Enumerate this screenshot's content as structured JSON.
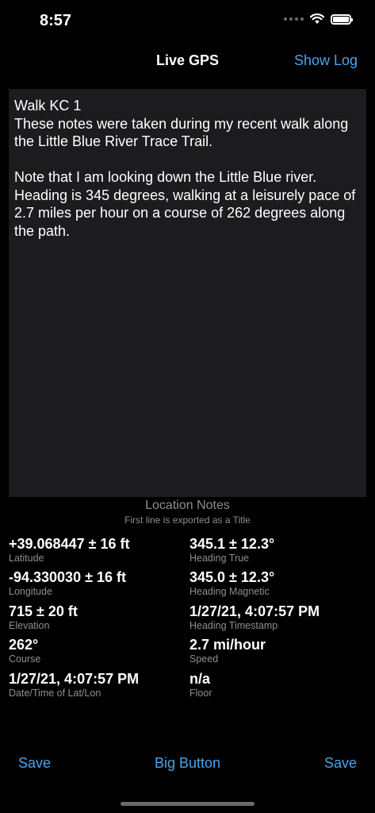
{
  "status_bar": {
    "time": "8:57"
  },
  "nav": {
    "title": "Live GPS",
    "show_log_label": "Show Log"
  },
  "notes": {
    "text": "Walk KC 1\nThese notes were taken during my recent walk along the Little Blue River Trace Trail.\n\nNote that I am looking down the Little Blue river. Heading is 345 degrees, walking at a leisurely pace of 2.7 miles per hour on a course of 262 degrees along the path.",
    "caption_title": "Location Notes",
    "caption_subtitle": "First line is exported as a Title"
  },
  "metrics": {
    "latitude": {
      "value": "+39.068447 ± 16 ft",
      "label": "Latitude"
    },
    "longitude": {
      "value": "-94.330030 ± 16 ft",
      "label": "Longitude"
    },
    "elevation": {
      "value": "715 ± 20 ft",
      "label": "Elevation"
    },
    "course": {
      "value": "262°",
      "label": "Course"
    },
    "datetime": {
      "value": "1/27/21, 4:07:57 PM",
      "label": "Date/Time of Lat/Lon"
    },
    "heading_true": {
      "value": "345.1 ± 12.3°",
      "label": "Heading True"
    },
    "heading_magnetic": {
      "value": "345.0 ± 12.3°",
      "label": "Heading Magnetic"
    },
    "heading_timestamp": {
      "value": "1/27/21, 4:07:57 PM",
      "label": "Heading Timestamp"
    },
    "speed": {
      "value": "2.7 mi/hour",
      "label": "Speed"
    },
    "floor": {
      "value": "n/a",
      "label": "Floor"
    }
  },
  "toolbar": {
    "save_left": "Save",
    "big_button": "Big Button",
    "save_right": "Save"
  },
  "colors": {
    "accent": "#4aa3ec",
    "background": "#000000",
    "text_field": "#1c1c1e",
    "secondary_text": "#8e8e93"
  },
  "icons": [
    "cellular-signal-icon",
    "wifi-icon",
    "battery-icon"
  ]
}
